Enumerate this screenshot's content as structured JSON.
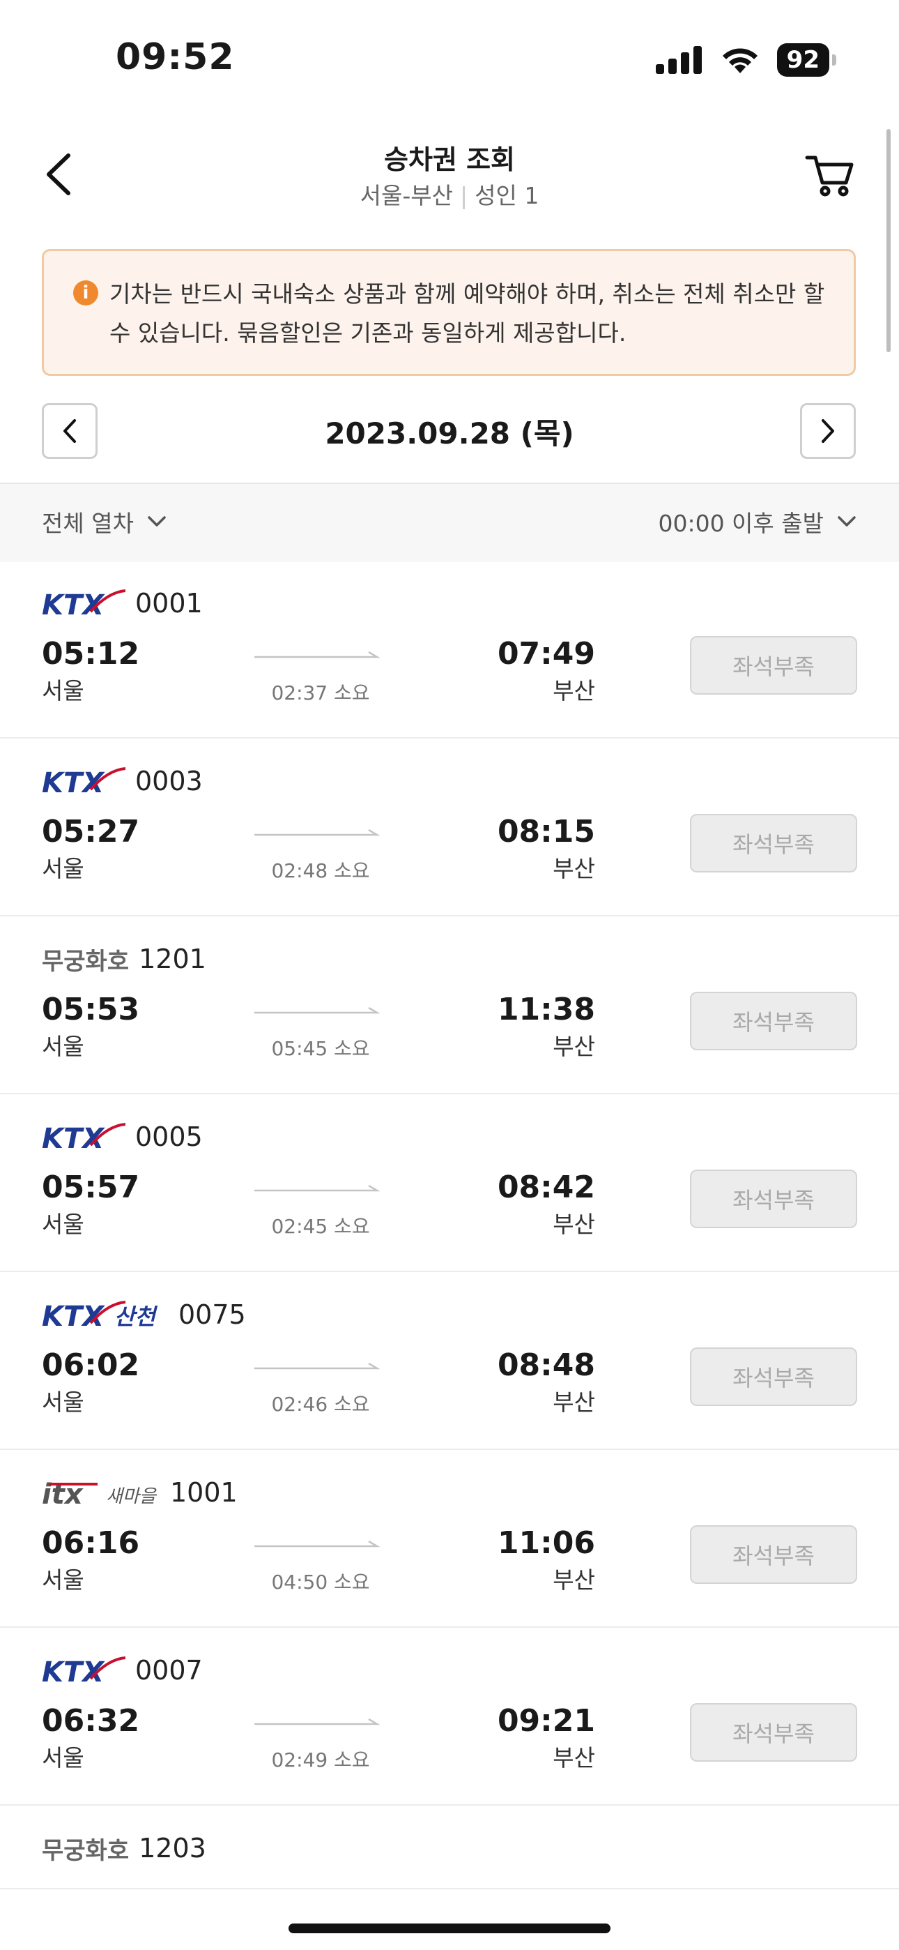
{
  "status_bar": {
    "time": "09:52",
    "battery": "92"
  },
  "header": {
    "title": "승차권 조회",
    "route": "서울-부산",
    "passenger": "성인 1"
  },
  "notice": {
    "text": "기차는 반드시 국내숙소 상품과 함께 예약해야 하며, 취소는 전체 취소만 할 수 있습니다. 묶음할인은 기존과 동일하게 제공합니다."
  },
  "date_bar": {
    "date": "2023.09.28 (목)"
  },
  "filters": {
    "train_type": "전체 열차",
    "departure": "00:00 이후 출발"
  },
  "trains": [
    {
      "brand": "KTX",
      "brand_label": "KTX",
      "number": "0001",
      "dep_time": "05:12",
      "dep_station": "서울",
      "duration": "02:37 소요",
      "arr_time": "07:49",
      "arr_station": "부산",
      "seat_status": "좌석부족"
    },
    {
      "brand": "KTX",
      "brand_label": "KTX",
      "number": "0003",
      "dep_time": "05:27",
      "dep_station": "서울",
      "duration": "02:48 소요",
      "arr_time": "08:15",
      "arr_station": "부산",
      "seat_status": "좌석부족"
    },
    {
      "brand": "MUGUNGHWA",
      "brand_label": "무궁화호",
      "number": "1201",
      "dep_time": "05:53",
      "dep_station": "서울",
      "duration": "05:45 소요",
      "arr_time": "11:38",
      "arr_station": "부산",
      "seat_status": "좌석부족"
    },
    {
      "brand": "KTX",
      "brand_label": "KTX",
      "number": "0005",
      "dep_time": "05:57",
      "dep_station": "서울",
      "duration": "02:45 소요",
      "arr_time": "08:42",
      "arr_station": "부산",
      "seat_status": "좌석부족"
    },
    {
      "brand": "KTX_SANCHEON",
      "brand_label": "KTX 산천",
      "number": "0075",
      "dep_time": "06:02",
      "dep_station": "서울",
      "duration": "02:46 소요",
      "arr_time": "08:48",
      "arr_station": "부산",
      "seat_status": "좌석부족"
    },
    {
      "brand": "ITX",
      "brand_label": "ITX 새마을",
      "number": "1001",
      "dep_time": "06:16",
      "dep_station": "서울",
      "duration": "04:50 소요",
      "arr_time": "11:06",
      "arr_station": "부산",
      "seat_status": "좌석부족"
    },
    {
      "brand": "KTX",
      "brand_label": "KTX",
      "number": "0007",
      "dep_time": "06:32",
      "dep_station": "서울",
      "duration": "02:49 소요",
      "arr_time": "09:21",
      "arr_station": "부산",
      "seat_status": "좌석부족"
    }
  ],
  "last_visible": {
    "brand_label": "무궁화호",
    "number": "1203"
  },
  "colors": {
    "ktx_blue": "#1f3a93",
    "ktx_red": "#c8102e",
    "notice_bg": "#fdf3ec",
    "notice_border": "#f2c9a3",
    "info_orange": "#f0892e"
  }
}
